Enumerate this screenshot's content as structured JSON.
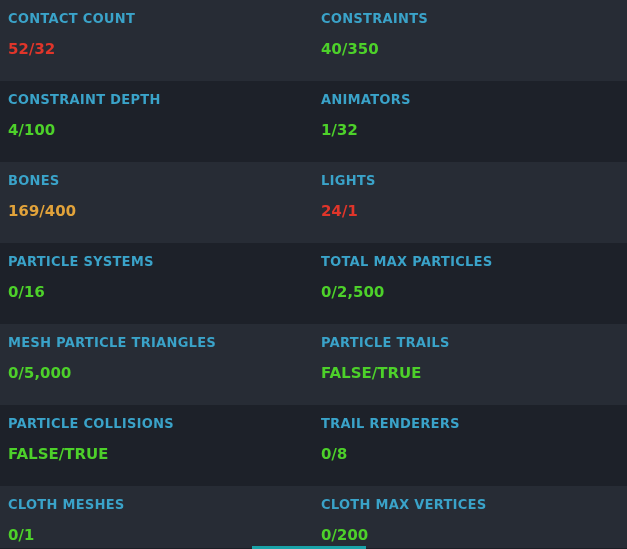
{
  "colors": {
    "ok": "#4dd12a",
    "bad": "#e0352a",
    "warn": "#e2a33a",
    "label": "#3aa3c9"
  },
  "stats": {
    "contact_count": {
      "label": "CONTACT COUNT",
      "value": "52/32",
      "status": "bad"
    },
    "constraints": {
      "label": "CONSTRAINTS",
      "value": "40/350",
      "status": "ok"
    },
    "constraint_depth": {
      "label": "CONSTRAINT DEPTH",
      "value": "4/100",
      "status": "ok"
    },
    "animators": {
      "label": "ANIMATORS",
      "value": "1/32",
      "status": "ok"
    },
    "bones": {
      "label": "BONES",
      "value": "169/400",
      "status": "warn"
    },
    "lights": {
      "label": "LIGHTS",
      "value": "24/1",
      "status": "bad"
    },
    "particle_systems": {
      "label": "PARTICLE SYSTEMS",
      "value": "0/16",
      "status": "ok"
    },
    "total_max_particles": {
      "label": "TOTAL MAX PARTICLES",
      "value": "0/2,500",
      "status": "ok"
    },
    "mesh_particle_triangles": {
      "label": "MESH PARTICLE TRIANGLES",
      "value": "0/5,000",
      "status": "ok"
    },
    "particle_trails": {
      "label": "PARTICLE TRAILS",
      "value": "FALSE/TRUE",
      "status": "ok"
    },
    "particle_collisions": {
      "label": "PARTICLE COLLISIONS",
      "value": "FALSE/TRUE",
      "status": "ok"
    },
    "trail_renderers": {
      "label": "TRAIL RENDERERS",
      "value": "0/8",
      "status": "ok"
    },
    "cloth_meshes": {
      "label": "CLOTH MESHES",
      "value": "0/1",
      "status": "ok"
    },
    "cloth_max_vertices": {
      "label": "CLOTH MAX VERTICES",
      "value": "0/200",
      "status": "ok"
    }
  }
}
